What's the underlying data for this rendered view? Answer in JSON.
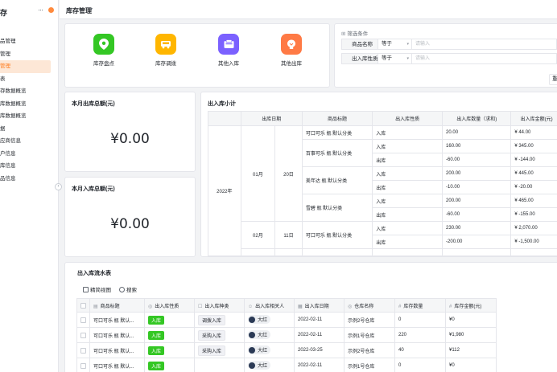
{
  "sidebar": {
    "title": "存",
    "items": [
      {
        "label": "品管理",
        "active": false
      },
      {
        "label": "管理",
        "active": false
      },
      {
        "label": "管理",
        "active": true
      },
      {
        "label": "表",
        "active": false
      },
      {
        "label": "存数据概览",
        "active": false
      },
      {
        "label": "库数据概览",
        "active": false
      },
      {
        "label": "库数据概览",
        "active": false
      },
      {
        "label": "据",
        "active": false
      },
      {
        "label": "应商信息",
        "active": false
      },
      {
        "label": "户信息",
        "active": false
      },
      {
        "label": "库信息",
        "active": false
      },
      {
        "label": "品信息",
        "active": false
      }
    ]
  },
  "header": {
    "title": "库存管理"
  },
  "actions": [
    {
      "label": "库存盘点",
      "color": "#34c724",
      "icon": "location-pin-icon"
    },
    {
      "label": "库存调拨",
      "color": "#ffb600",
      "icon": "truck-icon"
    },
    {
      "label": "其他入库",
      "color": "#7b61ff",
      "icon": "inbox-icon"
    },
    {
      "label": "其他出库",
      "color": "#ff7a45",
      "icon": "outbox-icon"
    }
  ],
  "filter": {
    "title": "筛选条件",
    "rows": [
      {
        "field": "商品名称",
        "op": "等于",
        "placeholder": "请输入"
      },
      {
        "field": "出入库性质",
        "op": "等于",
        "placeholder": "请输入"
      }
    ],
    "button_label": "重"
  },
  "metrics": {
    "out_title": "本月出库总额(元)",
    "out_value": "¥0.00",
    "in_title": "本月入库总额(元)",
    "in_value": "¥0.00"
  },
  "pivot": {
    "title": "出入库小计",
    "headers": [
      "出库日期",
      "商品标题",
      "出入库性质",
      "出入库数量（求和)",
      "出入库金额(元)"
    ],
    "year": "2022年",
    "groups": [
      {
        "month": "01月",
        "day": "20日",
        "products": [
          {
            "name": "可口可乐 瓶 默认分类",
            "rows": [
              {
                "type": "入库",
                "qty": "20.00",
                "amt": "¥ 44.00"
              }
            ]
          },
          {
            "name": "百事可乐 瓶 默认分类",
            "rows": [
              {
                "type": "入库",
                "qty": "160.00",
                "amt": "¥ 345.00"
              },
              {
                "type": "出库",
                "qty": "-60.00",
                "amt": "¥ -144.00"
              }
            ]
          },
          {
            "name": "美年达 瓶 默认分类",
            "rows": [
              {
                "type": "入库",
                "qty": "200.00",
                "amt": "¥ 445.00"
              },
              {
                "type": "出库",
                "qty": "-10.00",
                "amt": "¥ -20.00"
              }
            ]
          },
          {
            "name": "雪碧 瓶 默认分类",
            "rows": [
              {
                "type": "入库",
                "qty": "200.00",
                "amt": "¥ 465.00"
              },
              {
                "type": "出库",
                "qty": "-60.00",
                "amt": "¥ -155.00"
              }
            ]
          }
        ]
      },
      {
        "month": "02月",
        "day": "11日",
        "products": [
          {
            "name": "可口可乐 瓶 默认分类",
            "rows": [
              {
                "type": "入库",
                "qty": "230.00",
                "amt": "¥ 2,070.00"
              },
              {
                "type": "出库",
                "qty": "-200.00",
                "amt": "¥ -1,500.00"
              }
            ]
          }
        ]
      }
    ]
  },
  "flow": {
    "title": "出入库流水表",
    "toolbar": {
      "view": "精简视图",
      "search": "搜索"
    },
    "columns": [
      "商品标题",
      "出入库性质",
      "出入库种类",
      "出入库相关人",
      "出入库日期",
      "仓库名称",
      "库存数量",
      "库存金额(元)"
    ],
    "rows": [
      {
        "title": "可口可乐 瓶 默认...",
        "nature": "入库",
        "kind": "调拨入库",
        "person": "大红",
        "date": "2022-02-11",
        "warehouse": "示例2号仓库",
        "qty": "0",
        "amt": "¥0"
      },
      {
        "title": "可口可乐 瓶 默认...",
        "nature": "入库",
        "kind": "采购入库",
        "person": "大红",
        "date": "2022-02-11",
        "warehouse": "示例1号仓库",
        "qty": "220",
        "amt": "¥1,980"
      },
      {
        "title": "可口可乐 瓶 默认...",
        "nature": "入库",
        "kind": "采购入库",
        "person": "大红",
        "date": "2022-03-25",
        "warehouse": "示例2号仓库",
        "qty": "40",
        "amt": "¥112"
      },
      {
        "title": "可口可乐 瓶 默认...",
        "nature": "入库",
        "kind": "",
        "person": "大红",
        "date": "2022-02-11",
        "warehouse": "示例1号仓库",
        "qty": "0",
        "amt": "¥0"
      }
    ]
  }
}
